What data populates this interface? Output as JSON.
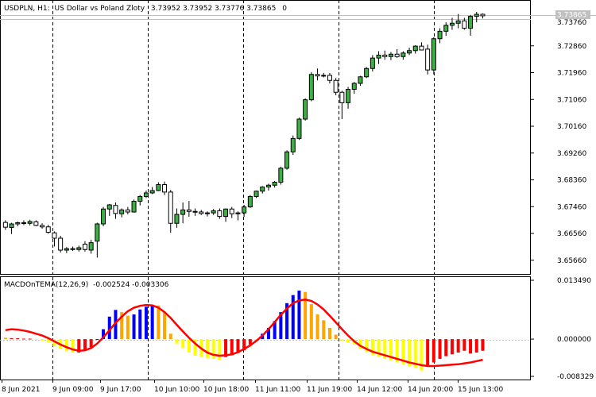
{
  "header": {
    "symbol": "USDPLN, H1:",
    "description": "US Dollar vs Poland Zloty",
    "ohlc": "3.73952 3.73952 3.73776 3.73865",
    "volume": "0"
  },
  "indicator": {
    "name": "MACDOnTEMA(12,26,9)",
    "values": "-0.002524 -0.003306"
  },
  "price_axis": {
    "ticks": [
      "3.72860",
      "3.71960",
      "3.71060",
      "3.70160",
      "3.69260",
      "3.68360",
      "3.67460",
      "3.66560",
      "3.65660"
    ],
    "current_price": "3.73865",
    "top_partial": "3.73760"
  },
  "indicator_axis": {
    "ticks": [
      "0.013490",
      "0.000000",
      "-0.008329"
    ]
  },
  "time_axis": {
    "labels": [
      "8 Jun 2021",
      "9 Jun 09:00",
      "9 Jun 17:00",
      "10 Jun 10:00",
      "10 Jun 18:00",
      "11 Jun 11:00",
      "11 Jun 19:00",
      "14 Jun 12:00",
      "14 Jun 20:00",
      "15 Jun 13:00"
    ]
  },
  "colors": {
    "bull_candle": "#3cb043",
    "bear_candle": "#ffffff",
    "histogram_blue": "#0000ff",
    "histogram_orange": "#ffa500",
    "histogram_yellow": "#ffff00",
    "histogram_red": "#ff0000",
    "signal_line": "#ff0000"
  },
  "chart_data": {
    "type": "candlestick",
    "price_ylim": [
      3.652,
      3.744
    ],
    "candles": [
      [
        3.6693,
        3.67,
        3.6668,
        3.6677
      ],
      [
        3.6676,
        3.6692,
        3.6654,
        3.6688
      ],
      [
        3.6688,
        3.6696,
        3.668,
        3.6692
      ],
      [
        3.6692,
        3.67,
        3.6684,
        3.669
      ],
      [
        3.669,
        3.6702,
        3.6683,
        3.6696
      ],
      [
        3.6695,
        3.67,
        3.668,
        3.6683
      ],
      [
        3.6683,
        3.669,
        3.6672,
        3.6678
      ],
      [
        3.6678,
        3.6685,
        3.6655,
        3.666
      ],
      [
        3.6658,
        3.6663,
        3.6612,
        3.664
      ],
      [
        3.664,
        3.6648,
        3.6592,
        3.66
      ],
      [
        3.66,
        3.661,
        3.659,
        3.6605
      ],
      [
        3.6605,
        3.6612,
        3.6597,
        3.6602
      ],
      [
        3.6602,
        3.6615,
        3.6595,
        3.6608
      ],
      [
        3.662,
        3.663,
        3.6595,
        3.6602
      ],
      [
        3.66,
        3.6635,
        3.6588,
        3.6625
      ],
      [
        3.663,
        3.6692,
        3.6575,
        3.6688
      ],
      [
        3.6688,
        3.6745,
        3.668,
        3.6738
      ],
      [
        3.6738,
        3.6755,
        3.6715,
        3.6752
      ],
      [
        3.675,
        3.676,
        3.6705,
        3.6723
      ],
      [
        3.6722,
        3.674,
        3.671,
        3.6735
      ],
      [
        3.6735,
        3.6745,
        3.672,
        3.6728
      ],
      [
        3.6728,
        3.677,
        3.6726,
        3.6764
      ],
      [
        3.6764,
        3.6785,
        3.675,
        3.678
      ],
      [
        3.678,
        3.68,
        3.6775,
        3.6792
      ],
      [
        3.6792,
        3.6812,
        3.6788,
        3.68
      ],
      [
        3.68,
        3.6828,
        3.6798,
        3.682
      ],
      [
        3.682,
        3.683,
        3.6785,
        3.6795
      ],
      [
        3.6795,
        3.6802,
        3.6658,
        3.669
      ],
      [
        3.669,
        3.674,
        3.6675,
        3.672
      ],
      [
        3.672,
        3.676,
        3.669,
        3.6735
      ],
      [
        3.6735,
        3.6765,
        3.6712,
        3.673
      ],
      [
        3.673,
        3.674,
        3.6715,
        3.6728
      ],
      [
        3.6728,
        3.6735,
        3.6718,
        3.6723
      ],
      [
        3.6723,
        3.673,
        3.6713,
        3.6725
      ],
      [
        3.6725,
        3.6738,
        3.6718,
        3.6732
      ],
      [
        3.6732,
        3.674,
        3.6705,
        3.6713
      ],
      [
        3.6713,
        3.674,
        3.6695,
        3.6738
      ],
      [
        3.6738,
        3.6745,
        3.6708,
        3.6722
      ],
      [
        3.6722,
        3.673,
        3.67,
        3.6725
      ],
      [
        3.6725,
        3.6752,
        3.6712,
        3.6745
      ],
      [
        3.6745,
        3.6785,
        3.6742,
        3.678
      ],
      [
        3.678,
        3.68,
        3.6775,
        3.6798
      ],
      [
        3.6798,
        3.6815,
        3.679,
        3.6812
      ],
      [
        3.6812,
        3.6823,
        3.68,
        3.6818
      ],
      [
        3.6818,
        3.6832,
        3.681,
        3.6828
      ],
      [
        3.6828,
        3.688,
        3.682,
        3.6875
      ],
      [
        3.6875,
        3.6935,
        3.687,
        3.693
      ],
      [
        3.693,
        3.6985,
        3.692,
        3.6975
      ],
      [
        3.6975,
        3.7045,
        3.697,
        3.704
      ],
      [
        3.704,
        3.711,
        3.7035,
        3.7105
      ],
      [
        3.7105,
        3.7198,
        3.71,
        3.719
      ],
      [
        3.719,
        3.721,
        3.717,
        3.7185
      ],
      [
        3.7185,
        3.7195,
        3.718,
        3.7187
      ],
      [
        3.7187,
        3.7195,
        3.716,
        3.717
      ],
      [
        3.717,
        3.7178,
        3.712,
        3.713
      ],
      [
        3.713,
        3.7135,
        3.704,
        3.7095
      ],
      [
        3.7095,
        3.7148,
        3.7075,
        3.714
      ],
      [
        3.714,
        3.7165,
        3.7125,
        3.716
      ],
      [
        3.716,
        3.7185,
        3.7152,
        3.7182
      ],
      [
        3.7182,
        3.7215,
        3.7178,
        3.721
      ],
      [
        3.721,
        3.7255,
        3.72,
        3.7245
      ],
      [
        3.7245,
        3.7268,
        3.7225,
        3.7255
      ],
      [
        3.7255,
        3.727,
        3.724,
        3.725
      ],
      [
        3.725,
        3.7265,
        3.7238,
        3.7258
      ],
      [
        3.7258,
        3.7275,
        3.7245,
        3.725
      ],
      [
        3.725,
        3.7268,
        3.724,
        3.7262
      ],
      [
        3.7262,
        3.728,
        3.7255,
        3.727
      ],
      [
        3.727,
        3.7288,
        3.726,
        3.7285
      ],
      [
        3.7285,
        3.7298,
        3.7275,
        3.7272
      ],
      [
        3.7275,
        3.729,
        3.719,
        3.7205
      ],
      [
        3.7205,
        3.7315,
        3.719,
        3.731
      ],
      [
        3.731,
        3.7345,
        3.7295,
        3.7335
      ],
      [
        3.7335,
        3.7365,
        3.732,
        3.7355
      ],
      [
        3.7355,
        3.738,
        3.734,
        3.7362
      ],
      [
        3.7362,
        3.7393,
        3.7345,
        3.737
      ],
      [
        3.737,
        3.738,
        3.734,
        3.7345
      ],
      [
        3.7345,
        3.739,
        3.732,
        3.7385
      ],
      [
        3.7385,
        3.74,
        3.7365,
        3.7392
      ],
      [
        3.7392,
        3.7395,
        3.7378,
        3.7387
      ]
    ],
    "macd_ylim": [
      -0.009,
      0.0138
    ],
    "histogram": [
      0.0003,
      0.0002,
      0.0002,
      0.0001,
      0.0001,
      0.0,
      -0.0003,
      -0.0008,
      -0.0016,
      -0.0022,
      -0.0027,
      -0.003,
      -0.003,
      -0.0026,
      -0.0018,
      0.0,
      0.0022,
      0.005,
      0.0065,
      0.006,
      0.0052,
      0.0055,
      0.0066,
      0.0072,
      0.0074,
      0.0075,
      0.006,
      0.0012,
      -0.001,
      -0.002,
      -0.003,
      -0.0037,
      -0.004,
      -0.0042,
      -0.0044,
      -0.0046,
      -0.004,
      -0.0036,
      -0.0031,
      -0.0025,
      -0.0012,
      0.0,
      0.0012,
      0.0025,
      0.004,
      0.006,
      0.008,
      0.0098,
      0.0108,
      0.0105,
      0.0078,
      0.0055,
      0.0042,
      0.0025,
      0.001,
      -0.0003,
      -0.0008,
      -0.0012,
      -0.0022,
      -0.0028,
      -0.0036,
      -0.004,
      -0.0044,
      -0.0048,
      -0.0052,
      -0.0056,
      -0.006,
      -0.0064,
      -0.007,
      -0.0058,
      -0.0052,
      -0.0044,
      -0.0038,
      -0.0034,
      -0.003,
      -0.0026,
      -0.0032,
      -0.003,
      -0.0026
    ],
    "histogram_colors": [
      "orange",
      "red",
      "red",
      "red",
      "red",
      "yellow",
      "yellow",
      "yellow",
      "yellow",
      "yellow",
      "yellow",
      "yellow",
      "red",
      "red",
      "red",
      "blue",
      "blue",
      "blue",
      "blue",
      "orange",
      "orange",
      "blue",
      "blue",
      "blue",
      "blue",
      "orange",
      "orange",
      "orange",
      "yellow",
      "yellow",
      "yellow",
      "yellow",
      "yellow",
      "yellow",
      "yellow",
      "yellow",
      "red",
      "red",
      "red",
      "red",
      "red",
      "yellow",
      "blue",
      "blue",
      "blue",
      "blue",
      "blue",
      "blue",
      "blue",
      "orange",
      "orange",
      "orange",
      "orange",
      "orange",
      "orange",
      "yellow",
      "yellow",
      "yellow",
      "yellow",
      "yellow",
      "yellow",
      "yellow",
      "yellow",
      "yellow",
      "yellow",
      "yellow",
      "yellow",
      "yellow",
      "yellow",
      "red",
      "red",
      "red",
      "red",
      "red",
      "red",
      "red",
      "red",
      "red",
      "red"
    ],
    "signal": [
      0.002,
      0.0022,
      0.0021,
      0.0019,
      0.0016,
      0.0012,
      0.0008,
      0.0002,
      -0.0005,
      -0.0012,
      -0.0018,
      -0.0023,
      -0.0026,
      -0.0025,
      -0.002,
      -0.001,
      0.0004,
      0.002,
      0.0036,
      0.005,
      0.0062,
      0.007,
      0.0074,
      0.0076,
      0.0075,
      0.007,
      0.006,
      0.0047,
      0.0032,
      0.0017,
      0.0003,
      -0.001,
      -0.0021,
      -0.003,
      -0.0035,
      -0.0037,
      -0.0036,
      -0.0034,
      -0.0029,
      -0.0022,
      -0.0014,
      -0.0004,
      0.0008,
      0.0022,
      0.0038,
      0.0054,
      0.0068,
      0.008,
      0.0086,
      0.0088,
      0.0085,
      0.0077,
      0.0066,
      0.0052,
      0.0037,
      0.0022,
      0.0008,
      -0.0005,
      -0.0015,
      -0.0022,
      -0.0028,
      -0.0032,
      -0.0036,
      -0.004,
      -0.0044,
      -0.0048,
      -0.0052,
      -0.0055,
      -0.0058,
      -0.006,
      -0.006,
      -0.0059,
      -0.0058,
      -0.0057,
      -0.0056,
      -0.0054,
      -0.0052,
      -0.0049,
      -0.0046
    ]
  }
}
